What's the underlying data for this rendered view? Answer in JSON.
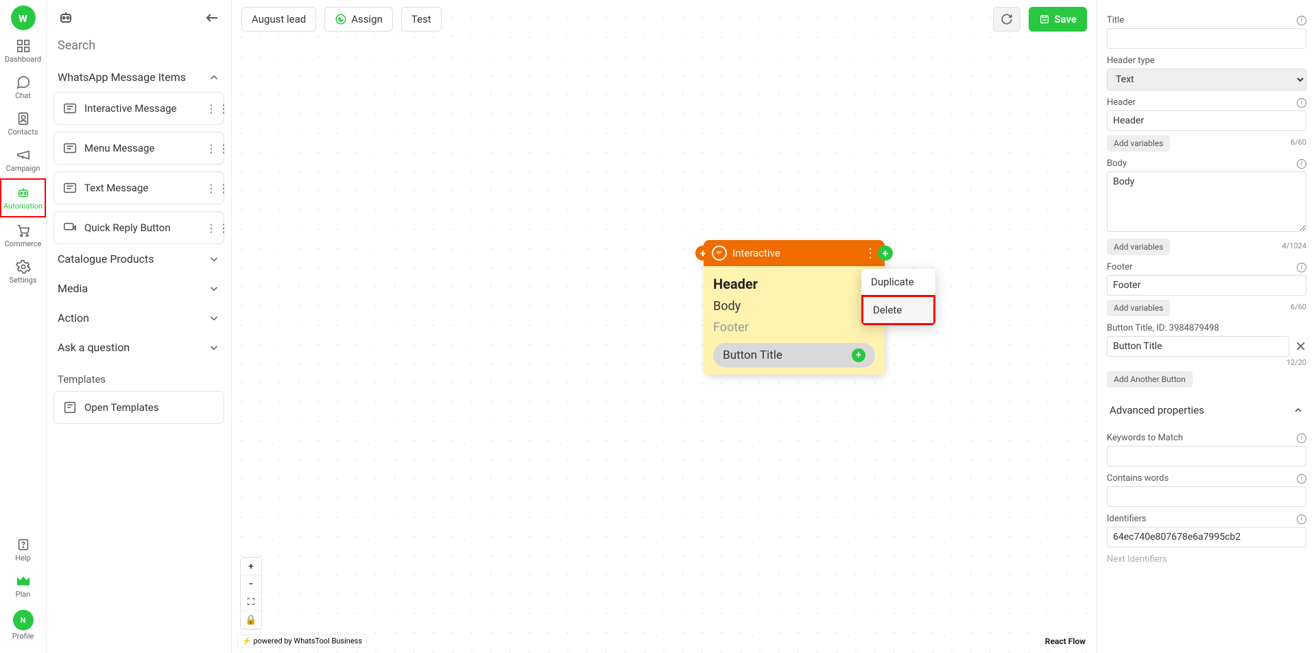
{
  "nav": {
    "items": [
      {
        "key": "dashboard",
        "label": "Dashboard"
      },
      {
        "key": "chat",
        "label": "Chat"
      },
      {
        "key": "contacts",
        "label": "Contacts"
      },
      {
        "key": "campaign",
        "label": "Campaign"
      },
      {
        "key": "automation",
        "label": "Automation"
      },
      {
        "key": "commerce",
        "label": "Commerce"
      },
      {
        "key": "settings",
        "label": "Settings"
      }
    ],
    "active": "automation",
    "highlighted": "automation",
    "bottom": [
      {
        "key": "help",
        "label": "Help"
      },
      {
        "key": "plan",
        "label": "Plan"
      },
      {
        "key": "profile",
        "label": "Profile",
        "initial": "N"
      }
    ]
  },
  "sidebar": {
    "search_placeholder": "Search",
    "section_title": "WhatsApp Message Items",
    "items": [
      {
        "label": "Interactive Message"
      },
      {
        "label": "Menu Message"
      },
      {
        "label": "Text Message"
      },
      {
        "label": "Quick Reply Button"
      }
    ],
    "collapsed_sections": [
      {
        "label": "Catalogue Products"
      },
      {
        "label": "Media"
      },
      {
        "label": "Action"
      },
      {
        "label": "Ask a question"
      }
    ],
    "templates_header": "Templates",
    "open_templates": "Open Templates"
  },
  "toolbar": {
    "name": "August lead",
    "assign": "Assign",
    "test": "Test",
    "save": "Save"
  },
  "node": {
    "title": "Interactive",
    "header": "Header",
    "body": "Body",
    "footer": "Footer",
    "button": "Button Title"
  },
  "context_menu": {
    "duplicate": "Duplicate",
    "delete": "Delete",
    "highlighted": "delete"
  },
  "canvas": {
    "powered_by": "powered by WhatsTool Business",
    "react_flow": "React Flow"
  },
  "props": {
    "title_label": "Title",
    "header_type_label": "Header type",
    "header_type_value": "Text",
    "header_label": "Header",
    "header_value": "Header",
    "header_counter": "6/60",
    "body_label": "Body",
    "body_value": "Body",
    "body_counter": "4/1024",
    "footer_label": "Footer",
    "footer_value": "Footer",
    "footer_counter": "6/60",
    "button_title_label": "Button Title, ID: 3984879498",
    "button_title_value": "Button Title",
    "button_title_counter": "12/20",
    "add_variables": "Add variables",
    "add_another_button": "Add Another Button",
    "advanced_header": "Advanced properties",
    "keywords_label": "Keywords to Match",
    "contains_words_label": "Contains words",
    "identifiers_label": "Identifiers",
    "identifiers_value": "64ec740e807678e6a7995cb2",
    "next_identifiers_label": "Next Identifiers"
  }
}
